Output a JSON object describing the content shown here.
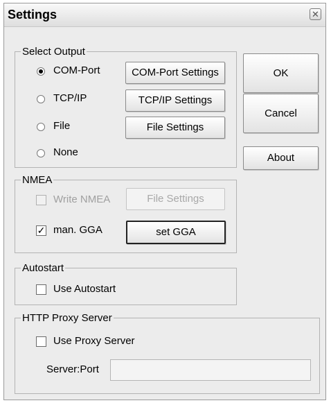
{
  "window": {
    "title": "Settings",
    "close_glyph": "✕"
  },
  "select_output": {
    "legend": "Select Output",
    "radios": [
      {
        "label": "COM-Port",
        "checked": true
      },
      {
        "label": "TCP/IP",
        "checked": false
      },
      {
        "label": "File",
        "checked": false
      },
      {
        "label": "None",
        "checked": false
      }
    ],
    "buttons": {
      "com": "COM-Port Settings",
      "tcp": "TCP/IP Settings",
      "file": "File Settings"
    }
  },
  "dialog_buttons": {
    "ok": "OK",
    "cancel": "Cancel",
    "about": "About"
  },
  "nmea": {
    "legend": "NMEA",
    "write_nmea": {
      "label": "Write NMEA",
      "checked": false,
      "enabled": false
    },
    "file_settings": "File Settings",
    "man_gga": {
      "label": "man. GGA",
      "checked": true,
      "check_glyph": "✓"
    },
    "set_gga": "set GGA"
  },
  "autostart": {
    "legend": "Autostart",
    "use_autostart": "Use Autostart",
    "checked": false
  },
  "proxy": {
    "legend": "HTTP Proxy Server",
    "use_proxy": "Use Proxy Server",
    "checked": false,
    "server_port_label": "Server:Port",
    "server_port_value": ""
  }
}
